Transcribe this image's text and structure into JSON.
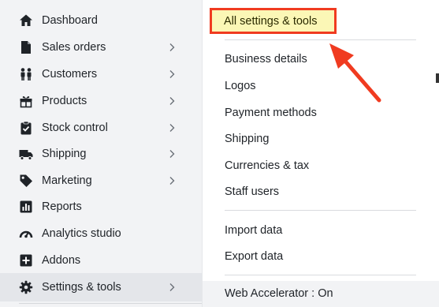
{
  "colors": {
    "sidebar_bg": "#f2f3f5",
    "active_bg": "#e4e6ea",
    "panel_bg": "#ffffff",
    "highlight_border": "#f03b20",
    "highlight_fill": "#fbf7b6",
    "arrow": "#f03b20"
  },
  "sidebar": {
    "items": [
      {
        "label": "Dashboard",
        "icon": "home-icon",
        "chevron": false
      },
      {
        "label": "Sales orders",
        "icon": "document-icon",
        "chevron": true
      },
      {
        "label": "Customers",
        "icon": "people-icon",
        "chevron": true
      },
      {
        "label": "Products",
        "icon": "gift-box-icon",
        "chevron": true
      },
      {
        "label": "Stock control",
        "icon": "clipboard-check-icon",
        "chevron": true
      },
      {
        "label": "Shipping",
        "icon": "truck-icon",
        "chevron": true
      },
      {
        "label": "Marketing",
        "icon": "tag-icon",
        "chevron": true
      },
      {
        "label": "Reports",
        "icon": "bar-chart-icon",
        "chevron": false
      },
      {
        "label": "Analytics studio",
        "icon": "gauge-icon",
        "chevron": false
      },
      {
        "label": "Addons",
        "icon": "plus-square-icon",
        "chevron": false
      },
      {
        "label": "Settings & tools",
        "icon": "gear-icon",
        "chevron": true,
        "active": true
      }
    ]
  },
  "panel": {
    "highlighted": "All settings & tools",
    "group1": [
      "Business details",
      "Logos",
      "Payment methods",
      "Shipping",
      "Currencies & tax",
      "Staff users"
    ],
    "group2": [
      "Import data",
      "Export data"
    ],
    "footer": "Web Accelerator : On"
  }
}
